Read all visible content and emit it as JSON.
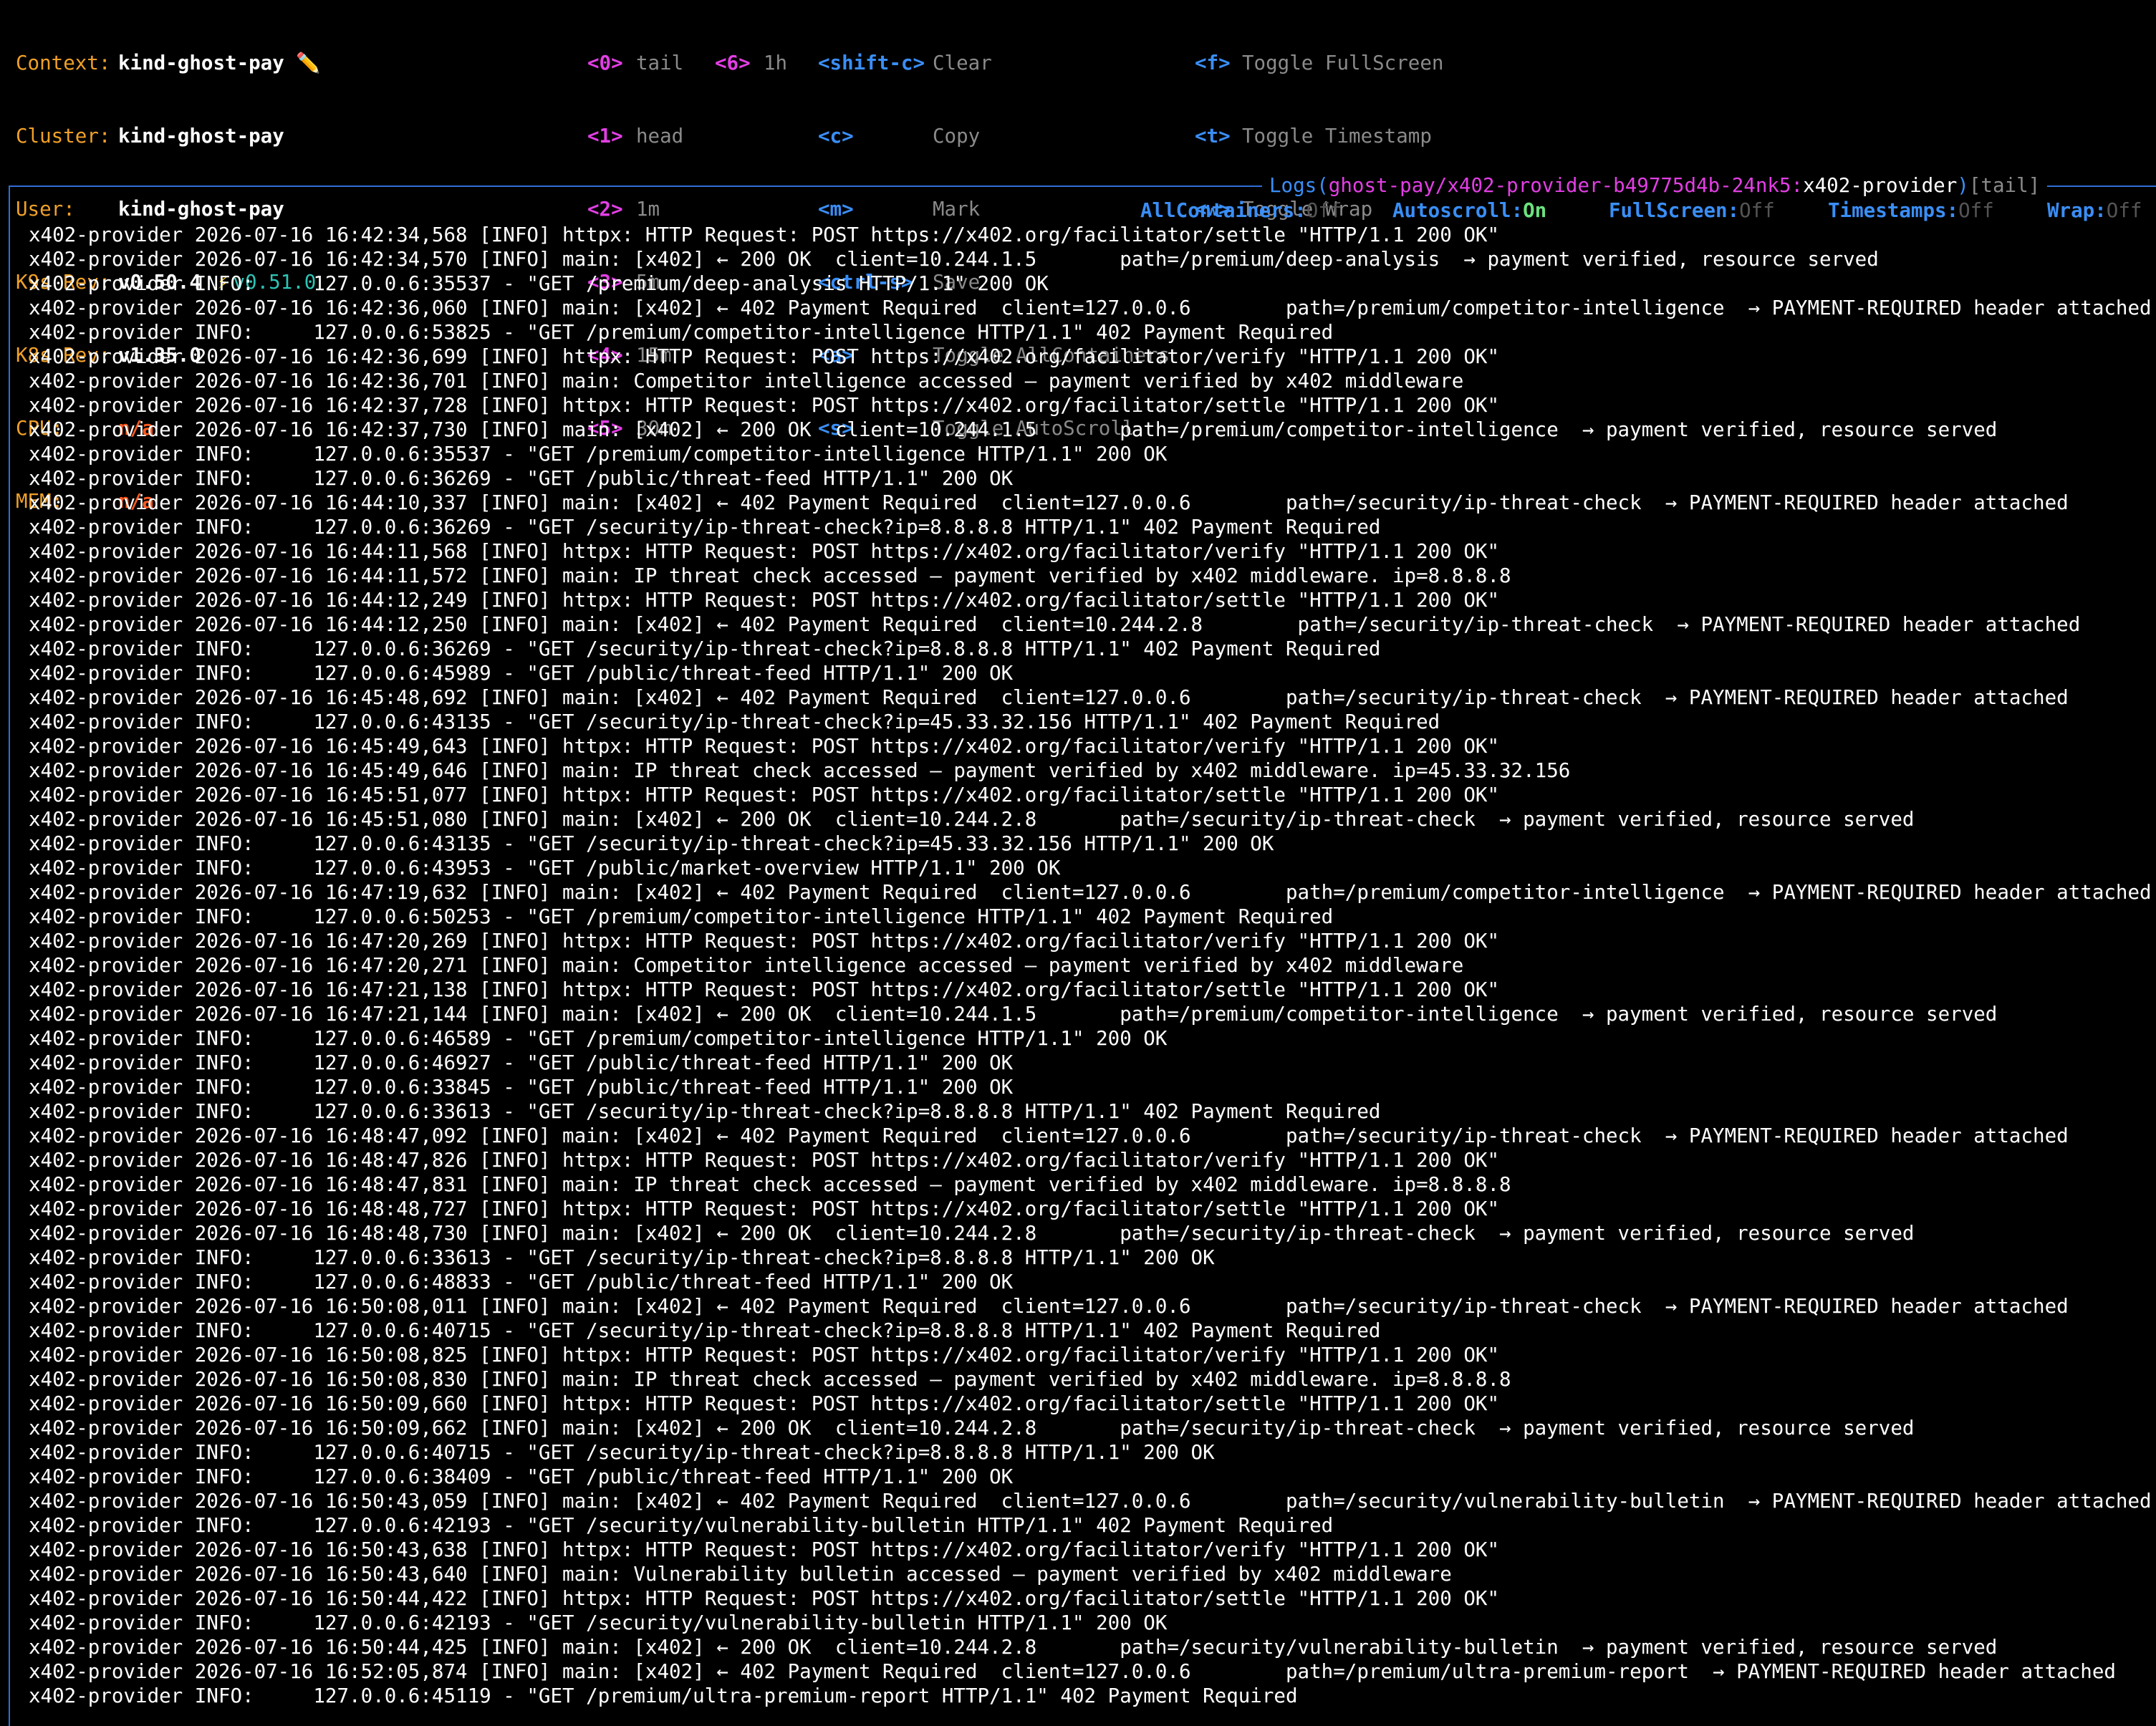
{
  "header": {
    "info": [
      {
        "label": "Context:",
        "value": "kind-ghost-pay",
        "icon": "pencil-icon",
        "icon_glyph": "✏️"
      },
      {
        "label": "Cluster:",
        "value": "kind-ghost-pay"
      },
      {
        "label": "User:",
        "value": "kind-ghost-pay"
      },
      {
        "label": "K9s Rev:",
        "value": "v0.50.4",
        "upgrade_icon": "lightning-icon",
        "upgrade_glyph": "⚡",
        "upgrade": "v0.51.0"
      },
      {
        "label": "K8s Rev:",
        "value": "v1.35.0"
      },
      {
        "label": "CPU:",
        "value": "n/a"
      },
      {
        "label": "MEM:",
        "value": "n/a"
      }
    ],
    "keys_col1": [
      {
        "key": "<0>",
        "desc": "tail"
      },
      {
        "key": "<1>",
        "desc": "head"
      },
      {
        "key": "<2>",
        "desc": "1m"
      },
      {
        "key": "<3>",
        "desc": "5m"
      },
      {
        "key": "<4>",
        "desc": "15m"
      },
      {
        "key": "<5>",
        "desc": "30m"
      }
    ],
    "keys_col2": [
      {
        "key": "<6>",
        "desc": "1h"
      }
    ],
    "keys_col3": [
      {
        "key": "<shift-c>",
        "desc": "Clear"
      },
      {
        "key": "<c>",
        "desc": "Copy"
      },
      {
        "key": "<m>",
        "desc": "Mark"
      },
      {
        "key": "<ctrl-s>",
        "desc": "Save"
      },
      {
        "key": "<a>",
        "desc": "Toggle AllContainers"
      },
      {
        "key": "<s>",
        "desc": "Toggle AutoScroll"
      }
    ],
    "keys_col4": [
      {
        "key": "<f>",
        "desc": "Toggle FullScreen"
      },
      {
        "key": "<t>",
        "desc": "Toggle Timestamp"
      },
      {
        "key": "<w>",
        "desc": "Toggle Wrap"
      }
    ]
  },
  "panel": {
    "title_label": "Logs(",
    "title_path": "ghost-pay/x402-provider-b49775d4b-24nk5:",
    "title_container": "x402-provider",
    "title_close": ")",
    "title_mode": "[tail]"
  },
  "status": [
    {
      "name": "AllContainers:",
      "value": "Off"
    },
    {
      "name": "Autoscroll:",
      "value": "On"
    },
    {
      "name": "FullScreen:",
      "value": "Off"
    },
    {
      "name": "Timestamps:",
      "value": "Off"
    },
    {
      "name": "Wrap:",
      "value": "Off"
    }
  ],
  "colors": {
    "accent": "#3a8ef6",
    "magenta": "#e23fe4",
    "orange": "#f0a028",
    "green": "#6be37f",
    "red": "#ff5a1f"
  },
  "logs": {
    "source": "x402-provider",
    "lines": [
      "2026-07-16 16:42:34,568 [INFO] httpx: HTTP Request: POST https://x402.org/facilitator/settle \"HTTP/1.1 200 OK\"",
      "2026-07-16 16:42:34,570 [INFO] main: [x402] ← 200 OK  client=10.244.1.5       path=/premium/deep-analysis  → payment verified, resource served",
      "INFO:     127.0.0.6:35537 - \"GET /premium/deep-analysis HTTP/1.1\" 200 OK",
      "2026-07-16 16:42:36,060 [INFO] main: [x402] ← 402 Payment Required  client=127.0.0.6        path=/premium/competitor-intelligence  → PAYMENT-REQUIRED header attached",
      "INFO:     127.0.0.6:53825 - \"GET /premium/competitor-intelligence HTTP/1.1\" 402 Payment Required",
      "2026-07-16 16:42:36,699 [INFO] httpx: HTTP Request: POST https://x402.org/facilitator/verify \"HTTP/1.1 200 OK\"",
      "2026-07-16 16:42:36,701 [INFO] main: Competitor intelligence accessed — payment verified by x402 middleware",
      "2026-07-16 16:42:37,728 [INFO] httpx: HTTP Request: POST https://x402.org/facilitator/settle \"HTTP/1.1 200 OK\"",
      "2026-07-16 16:42:37,730 [INFO] main: [x402] ← 200 OK  client=10.244.1.5       path=/premium/competitor-intelligence  → payment verified, resource served",
      "INFO:     127.0.0.6:35537 - \"GET /premium/competitor-intelligence HTTP/1.1\" 200 OK",
      "INFO:     127.0.0.6:36269 - \"GET /public/threat-feed HTTP/1.1\" 200 OK",
      "2026-07-16 16:44:10,337 [INFO] main: [x402] ← 402 Payment Required  client=127.0.0.6        path=/security/ip-threat-check  → PAYMENT-REQUIRED header attached",
      "INFO:     127.0.0.6:36269 - \"GET /security/ip-threat-check?ip=8.8.8.8 HTTP/1.1\" 402 Payment Required",
      "2026-07-16 16:44:11,568 [INFO] httpx: HTTP Request: POST https://x402.org/facilitator/verify \"HTTP/1.1 200 OK\"",
      "2026-07-16 16:44:11,572 [INFO] main: IP threat check accessed — payment verified by x402 middleware. ip=8.8.8.8",
      "2026-07-16 16:44:12,249 [INFO] httpx: HTTP Request: POST https://x402.org/facilitator/settle \"HTTP/1.1 200 OK\"",
      "2026-07-16 16:44:12,250 [INFO] main: [x402] ← 402 Payment Required  client=10.244.2.8        path=/security/ip-threat-check  → PAYMENT-REQUIRED header attached",
      "INFO:     127.0.0.6:36269 - \"GET /security/ip-threat-check?ip=8.8.8.8 HTTP/1.1\" 402 Payment Required",
      "INFO:     127.0.0.6:45989 - \"GET /public/threat-feed HTTP/1.1\" 200 OK",
      "2026-07-16 16:45:48,692 [INFO] main: [x402] ← 402 Payment Required  client=127.0.0.6        path=/security/ip-threat-check  → PAYMENT-REQUIRED header attached",
      "INFO:     127.0.0.6:43135 - \"GET /security/ip-threat-check?ip=45.33.32.156 HTTP/1.1\" 402 Payment Required",
      "2026-07-16 16:45:49,643 [INFO] httpx: HTTP Request: POST https://x402.org/facilitator/verify \"HTTP/1.1 200 OK\"",
      "2026-07-16 16:45:49,646 [INFO] main: IP threat check accessed — payment verified by x402 middleware. ip=45.33.32.156",
      "2026-07-16 16:45:51,077 [INFO] httpx: HTTP Request: POST https://x402.org/facilitator/settle \"HTTP/1.1 200 OK\"",
      "2026-07-16 16:45:51,080 [INFO] main: [x402] ← 200 OK  client=10.244.2.8       path=/security/ip-threat-check  → payment verified, resource served",
      "INFO:     127.0.0.6:43135 - \"GET /security/ip-threat-check?ip=45.33.32.156 HTTP/1.1\" 200 OK",
      "INFO:     127.0.0.6:43953 - \"GET /public/market-overview HTTP/1.1\" 200 OK",
      "2026-07-16 16:47:19,632 [INFO] main: [x402] ← 402 Payment Required  client=127.0.0.6        path=/premium/competitor-intelligence  → PAYMENT-REQUIRED header attached",
      "INFO:     127.0.0.6:50253 - \"GET /premium/competitor-intelligence HTTP/1.1\" 402 Payment Required",
      "2026-07-16 16:47:20,269 [INFO] httpx: HTTP Request: POST https://x402.org/facilitator/verify \"HTTP/1.1 200 OK\"",
      "2026-07-16 16:47:20,271 [INFO] main: Competitor intelligence accessed — payment verified by x402 middleware",
      "2026-07-16 16:47:21,138 [INFO] httpx: HTTP Request: POST https://x402.org/facilitator/settle \"HTTP/1.1 200 OK\"",
      "2026-07-16 16:47:21,144 [INFO] main: [x402] ← 200 OK  client=10.244.1.5       path=/premium/competitor-intelligence  → payment verified, resource served",
      "INFO:     127.0.0.6:46589 - \"GET /premium/competitor-intelligence HTTP/1.1\" 200 OK",
      "INFO:     127.0.0.6:46927 - \"GET /public/threat-feed HTTP/1.1\" 200 OK",
      "INFO:     127.0.0.6:33845 - \"GET /public/threat-feed HTTP/1.1\" 200 OK",
      "INFO:     127.0.0.6:33613 - \"GET /security/ip-threat-check?ip=8.8.8.8 HTTP/1.1\" 402 Payment Required",
      "2026-07-16 16:48:47,092 [INFO] main: [x402] ← 402 Payment Required  client=127.0.0.6        path=/security/ip-threat-check  → PAYMENT-REQUIRED header attached",
      "2026-07-16 16:48:47,826 [INFO] httpx: HTTP Request: POST https://x402.org/facilitator/verify \"HTTP/1.1 200 OK\"",
      "2026-07-16 16:48:47,831 [INFO] main: IP threat check accessed — payment verified by x402 middleware. ip=8.8.8.8",
      "2026-07-16 16:48:48,727 [INFO] httpx: HTTP Request: POST https://x402.org/facilitator/settle \"HTTP/1.1 200 OK\"",
      "2026-07-16 16:48:48,730 [INFO] main: [x402] ← 200 OK  client=10.244.2.8       path=/security/ip-threat-check  → payment verified, resource served",
      "INFO:     127.0.0.6:33613 - \"GET /security/ip-threat-check?ip=8.8.8.8 HTTP/1.1\" 200 OK",
      "INFO:     127.0.0.6:48833 - \"GET /public/threat-feed HTTP/1.1\" 200 OK",
      "2026-07-16 16:50:08,011 [INFO] main: [x402] ← 402 Payment Required  client=127.0.0.6        path=/security/ip-threat-check  → PAYMENT-REQUIRED header attached",
      "INFO:     127.0.0.6:40715 - \"GET /security/ip-threat-check?ip=8.8.8.8 HTTP/1.1\" 402 Payment Required",
      "2026-07-16 16:50:08,825 [INFO] httpx: HTTP Request: POST https://x402.org/facilitator/verify \"HTTP/1.1 200 OK\"",
      "2026-07-16 16:50:08,830 [INFO] main: IP threat check accessed — payment verified by x402 middleware. ip=8.8.8.8",
      "2026-07-16 16:50:09,660 [INFO] httpx: HTTP Request: POST https://x402.org/facilitator/settle \"HTTP/1.1 200 OK\"",
      "2026-07-16 16:50:09,662 [INFO] main: [x402] ← 200 OK  client=10.244.2.8       path=/security/ip-threat-check  → payment verified, resource served",
      "INFO:     127.0.0.6:40715 - \"GET /security/ip-threat-check?ip=8.8.8.8 HTTP/1.1\" 200 OK",
      "INFO:     127.0.0.6:38409 - \"GET /public/threat-feed HTTP/1.1\" 200 OK",
      "2026-07-16 16:50:43,059 [INFO] main: [x402] ← 402 Payment Required  client=127.0.0.6        path=/security/vulnerability-bulletin  → PAYMENT-REQUIRED header attached",
      "INFO:     127.0.0.6:42193 - \"GET /security/vulnerability-bulletin HTTP/1.1\" 402 Payment Required",
      "2026-07-16 16:50:43,638 [INFO] httpx: HTTP Request: POST https://x402.org/facilitator/verify \"HTTP/1.1 200 OK\"",
      "2026-07-16 16:50:43,640 [INFO] main: Vulnerability bulletin accessed — payment verified by x402 middleware",
      "2026-07-16 16:50:44,422 [INFO] httpx: HTTP Request: POST https://x402.org/facilitator/settle \"HTTP/1.1 200 OK\"",
      "INFO:     127.0.0.6:42193 - \"GET /security/vulnerability-bulletin HTTP/1.1\" 200 OK",
      "2026-07-16 16:50:44,425 [INFO] main: [x402] ← 200 OK  client=10.244.2.8       path=/security/vulnerability-bulletin  → payment verified, resource served",
      "2026-07-16 16:52:05,874 [INFO] main: [x402] ← 402 Payment Required  client=127.0.0.6        path=/premium/ultra-premium-report  → PAYMENT-REQUIRED header attached",
      "INFO:     127.0.0.6:45119 - \"GET /premium/ultra-premium-report HTTP/1.1\" 402 Payment Required"
    ]
  }
}
